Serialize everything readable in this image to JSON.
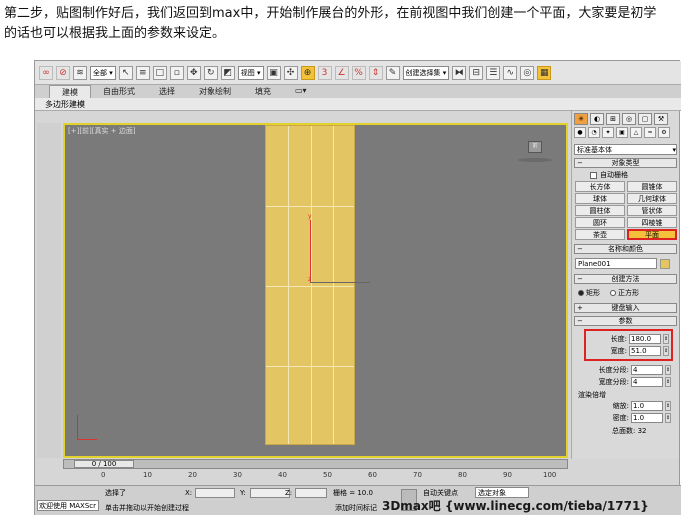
{
  "intro": {
    "line1": "第二步，贴图制作好后，我们返回到max中，开始制作展台的外形，在前视图中我们创建一个平面，大家要是初学",
    "line2": "的话也可以根据我上面的参数来设定。"
  },
  "toolbar": {
    "selection_filter": "全部",
    "view_dropdown": "视图",
    "named_selection": "创建选择集",
    "num_labels": [
      "3",
      "%"
    ]
  },
  "ribbon": {
    "tabs": [
      "建模",
      "自由形式",
      "选择",
      "对象绘制",
      "填充"
    ],
    "sub_label": "多边形建模"
  },
  "viewport": {
    "label": "[+][前][真实 + 边面]",
    "gizmo_y": "y",
    "gizmo_z": "z",
    "cube_label": "前"
  },
  "command_panel": {
    "category_dropdown": "标准基本体",
    "object_type": {
      "title": "对象类型",
      "autogrid": "自动栅格",
      "buttons": [
        "长方体",
        "圆锥体",
        "球体",
        "几何球体",
        "圆柱体",
        "管状体",
        "圆环",
        "四棱锥",
        "茶壶",
        "平面"
      ],
      "selected": "平面"
    },
    "name_color": {
      "title": "名称和颜色",
      "name": "Plane001",
      "color": "#e3c564"
    },
    "creation_method": {
      "title": "创建方法",
      "options": [
        "矩形",
        "正方形"
      ],
      "selected": "矩形"
    },
    "keyboard_entry": "键盘输入",
    "parameters": {
      "title": "参数",
      "length_label": "长度:",
      "length": "180.0",
      "width_label": "宽度:",
      "width": "51.0",
      "length_segs_label": "长度分段:",
      "length_segs": "4",
      "width_segs_label": "宽度分段:",
      "width_segs": "4",
      "render_multipliers": "渲染倍增",
      "scale_label": "缩放:",
      "scale": "1.0",
      "density_label": "密度:",
      "density": "1.0",
      "faces_label": "总面数:",
      "faces": "32"
    }
  },
  "timeline": {
    "position": "0 / 100",
    "ticks": [
      "0",
      "10",
      "20",
      "30",
      "40",
      "50",
      "60",
      "70",
      "80",
      "90",
      "100"
    ]
  },
  "status": {
    "welcome": "欢迎使用 MAXScr",
    "selection": "选择了",
    "hint": "单击并拖动以开始创建过程",
    "x_label": "X:",
    "y_label": "Y:",
    "z_label": "Z:",
    "grid": "栅格 = 10.0",
    "autokey": "自动关键点",
    "selected_object": "选定对象",
    "add_time_tag": "添加时间标记"
  },
  "watermark": "3Dmax吧 {www.linecg.com/tieba/1771}"
}
